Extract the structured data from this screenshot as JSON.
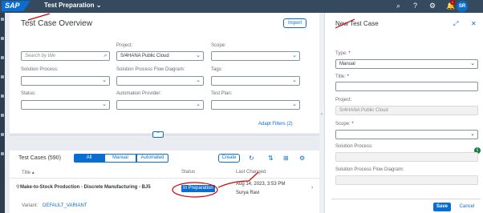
{
  "shell": {
    "logo_text": "SAP",
    "app_title": "Test Preparation",
    "app_title_chevron": "⌄",
    "notification_count": "1",
    "avatar_initials": "SR"
  },
  "overview": {
    "title": "Test Case Overview",
    "import_label": "Import",
    "filters": {
      "search_placeholder": "Search by title",
      "project_label": "Project:",
      "project_value": "S/4HANA Public Cloud",
      "scope_label": "Scope:",
      "solution_process_label": "Solution Process:",
      "solution_process_flow_label": "Solution Process Flow Diagram:",
      "tags_label": "Tags:",
      "status_label": "Status:",
      "automation_provider_label": "Automation Provider:",
      "test_plan_label": "Test Plan:",
      "adapt_filters_label": "Adapt Filters (2)"
    }
  },
  "table": {
    "title": "Test Cases (590)",
    "segments": [
      "All",
      "Manual",
      "Automated"
    ],
    "active_segment": "All",
    "create_label": "Create",
    "columns": {
      "title": "Title",
      "status": "Status",
      "last_changed": "Last Changed"
    },
    "rows": [
      {
        "title": "Make-to-Stock Production - Discrete Manufacturing - BJ5",
        "status": "In Preparation",
        "date": "Aug 14, 2023, 3:53 PM",
        "user": "Surya Ravi"
      }
    ],
    "variant_label": "Variant:",
    "variant_value": "DEFAULT_VARIANT"
  },
  "new_test_case": {
    "title": "New Test Case",
    "type_label": "Type:",
    "type_value": "Manual",
    "title_label": "Title:",
    "project_label": "Project:",
    "project_value": "S/4HANA Public Cloud",
    "scope_label": "Scope:",
    "solution_process_label": "Solution Process:",
    "solution_process_flow_label": "Solution Process Flow Diagram:",
    "required_marker": "*",
    "save_label": "Save",
    "cancel_label": "Cancel"
  },
  "colors": {
    "shell": "#354a5f",
    "brand": "#0a6ed1",
    "annotation": "#d40000",
    "info": "#107e3e"
  }
}
